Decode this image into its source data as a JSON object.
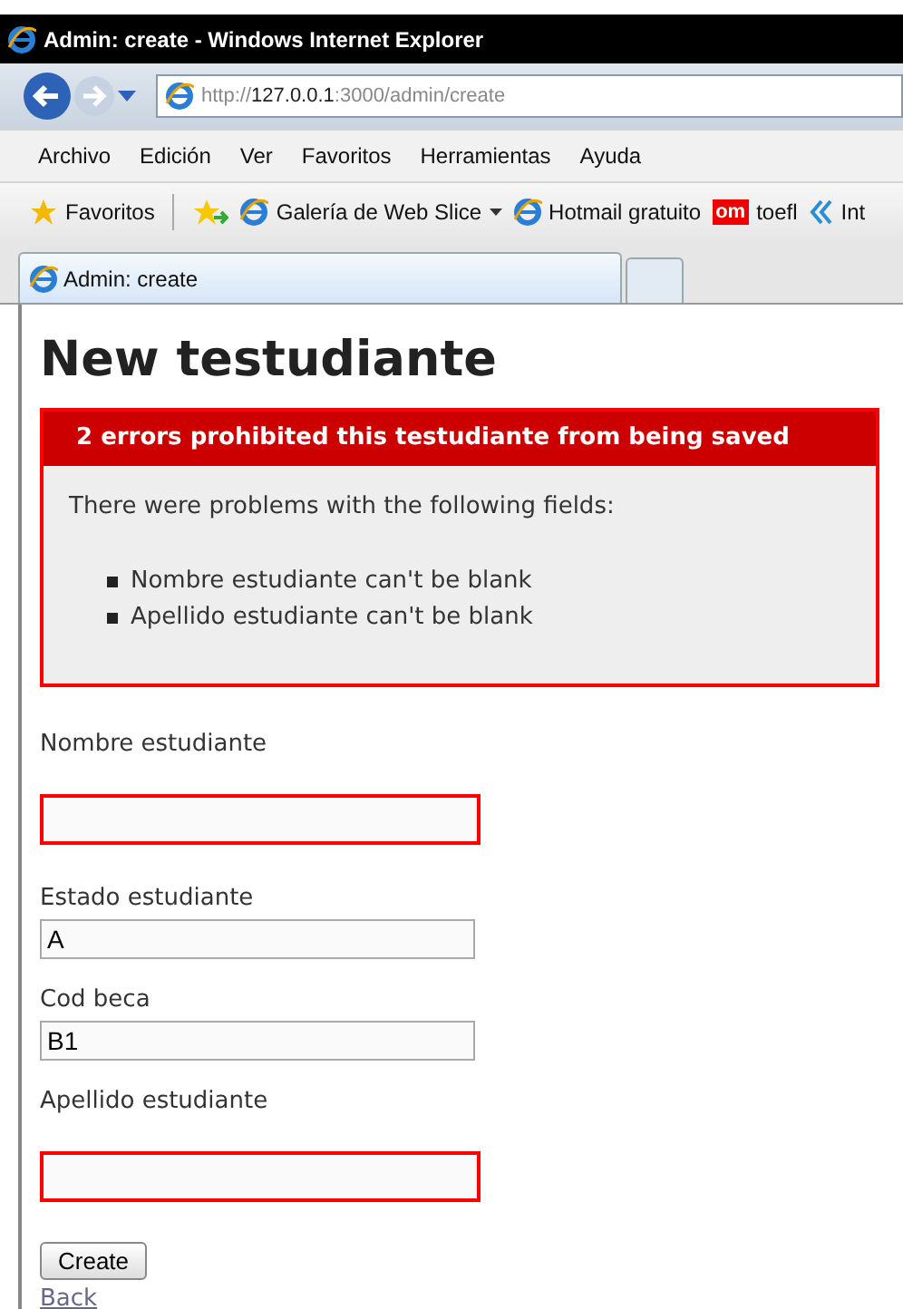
{
  "window": {
    "title": "Admin: create - Windows Internet Explorer"
  },
  "address": {
    "prefix": "http://",
    "host": "127.0.0.1",
    "rest": ":3000/admin/create"
  },
  "menu": [
    "Archivo",
    "Edición",
    "Ver",
    "Favoritos",
    "Herramientas",
    "Ayuda"
  ],
  "favorites_bar": {
    "favorites": "Favoritos",
    "links": [
      {
        "kind": "ie",
        "label": "Galería de Web Slice",
        "dropdown": true
      },
      {
        "kind": "ie",
        "label": "Hotmail gratuito",
        "dropdown": false
      },
      {
        "kind": "om",
        "badge": "om",
        "label": "toefl",
        "dropdown": false
      },
      {
        "kind": "chevrons",
        "label": "Int",
        "dropdown": false
      }
    ]
  },
  "tabs": [
    {
      "label": "Admin: create",
      "selected": true
    }
  ],
  "page": {
    "heading": "New testudiante",
    "errors": {
      "title": "2 errors prohibited this testudiante from being saved",
      "intro": "There were problems with the following fields:",
      "items": [
        "Nombre estudiante can't be blank",
        "Apellido estudiante can't be blank"
      ]
    },
    "fields": [
      {
        "label": "Nombre estudiante",
        "error": true
      },
      {
        "label": "Estado estudiante",
        "value": "A",
        "error": false
      },
      {
        "label": "Cod beca",
        "value": "B1",
        "error": false
      },
      {
        "label": "Apellido estudiante",
        "error": true
      }
    ],
    "submit": "Create",
    "back_link": "Back"
  }
}
